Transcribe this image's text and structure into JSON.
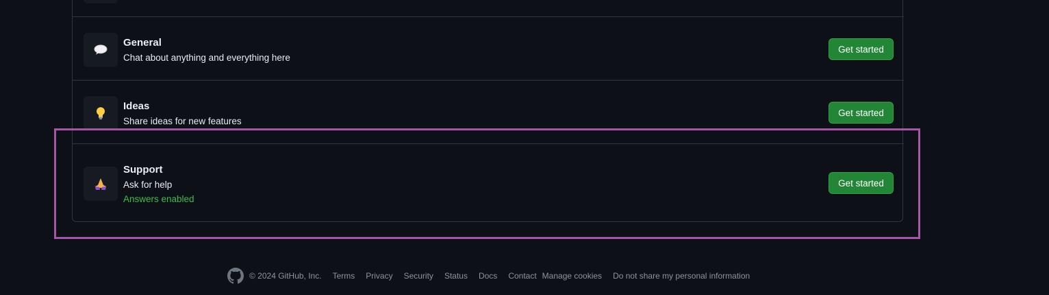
{
  "categories": [
    {
      "name": "General",
      "description": "Chat about anything and everything here",
      "emoji": "speech-balloon-icon",
      "button_label": "Get started"
    },
    {
      "name": "Ideas",
      "description": "Share ideas for new features",
      "emoji": "light-bulb-icon",
      "button_label": "Get started"
    },
    {
      "name": "Support",
      "description": "Ask for help",
      "badge": "Answers enabled",
      "emoji": "folded-hands-icon",
      "button_label": "Get started"
    }
  ],
  "footer": {
    "copyright": "© 2024 GitHub, Inc.",
    "links": [
      "Terms",
      "Privacy",
      "Security",
      "Status",
      "Docs",
      "Contact",
      "Manage cookies",
      "Do not share my personal information"
    ]
  },
  "colors": {
    "background": "#0d1117",
    "button": "#238636",
    "answers": "#3fb950",
    "highlight": "#a855a8"
  }
}
